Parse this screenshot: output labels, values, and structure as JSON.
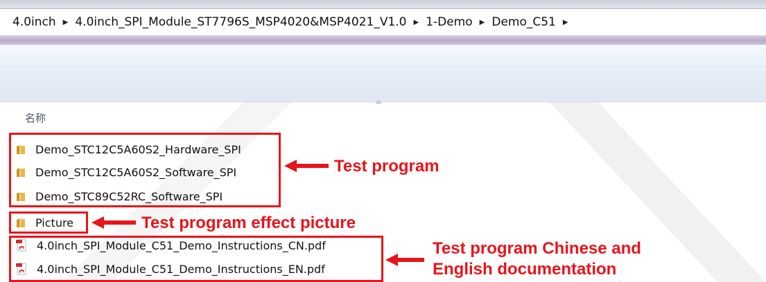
{
  "breadcrumb": {
    "items": [
      "4.0inch",
      "4.0inch_SPI_Module_ST7796S_MSP4020&MSP4021_V1.0",
      "1-Demo",
      "Demo_C51"
    ],
    "separator": "▶"
  },
  "list": {
    "column_header": "名称",
    "items": [
      {
        "name": "Demo_STC12C5A60S2_Hardware_SPI",
        "type": "folder"
      },
      {
        "name": "Demo_STC12C5A60S2_Software_SPI",
        "type": "folder"
      },
      {
        "name": "Demo_STC89C52RC_Software_SPI",
        "type": "folder"
      },
      {
        "name": "Picture",
        "type": "folder"
      },
      {
        "name": "4.0inch_SPI_Module_C51_Demo_Instructions_CN.pdf",
        "type": "pdf"
      },
      {
        "name": "4.0inch_SPI_Module_C51_Demo_Instructions_EN.pdf",
        "type": "pdf"
      }
    ]
  },
  "annotations": {
    "test_program": "Test program",
    "effect_picture": "Test program effect picture",
    "doc_line1": "Test program Chinese and",
    "doc_line2": "English documentation"
  },
  "colors": {
    "annotation_red": "#e8141b",
    "folder_yellow": "#e8b84a",
    "watermark": "#efefef"
  },
  "icons": {
    "folder": "folder-icon",
    "pdf": "pdf-icon",
    "sort": "sort-arrow-icon"
  }
}
